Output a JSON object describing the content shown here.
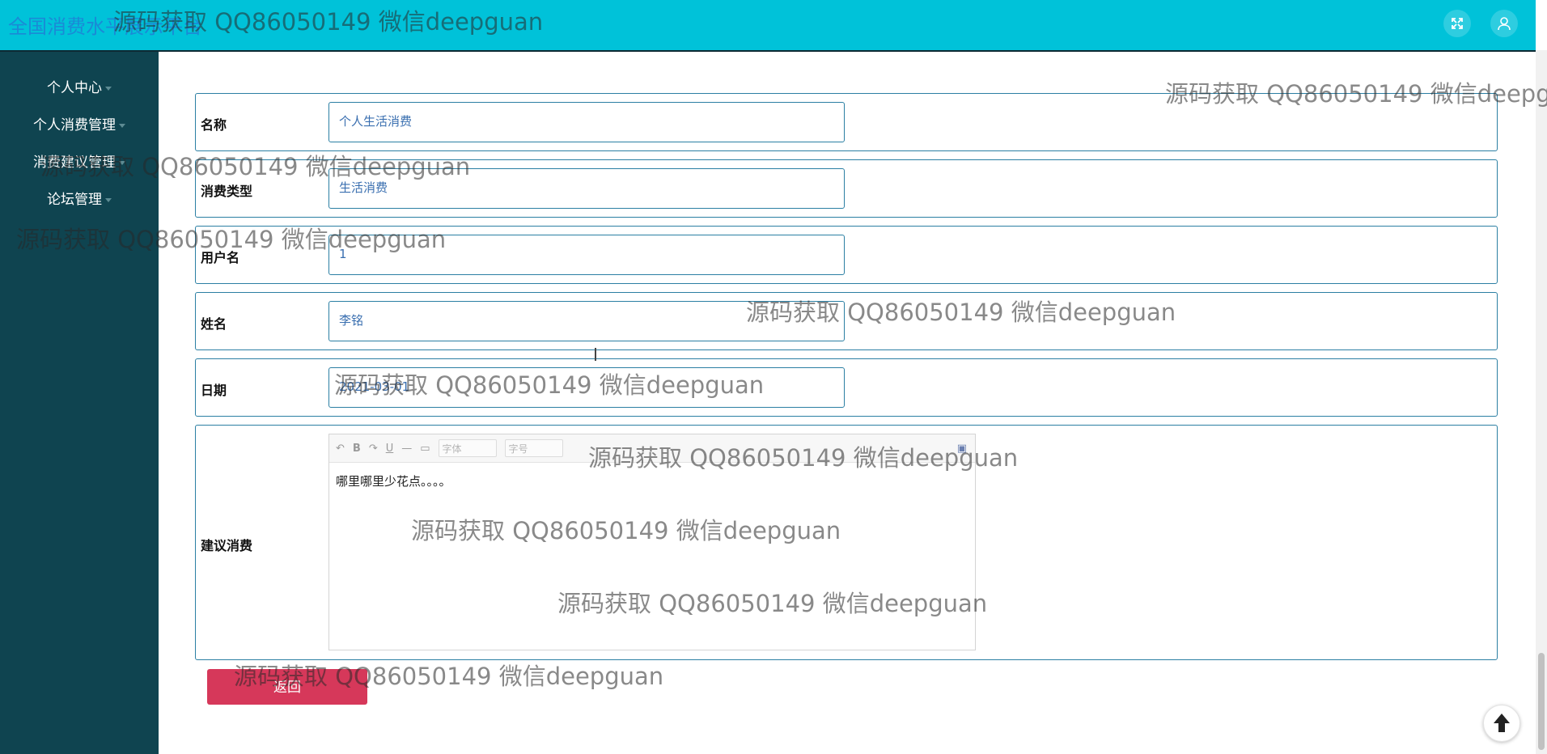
{
  "app": {
    "title": "全国消费水平展示平台"
  },
  "header": {
    "fullscreen_icon": "expand-icon",
    "user_icon": "user-icon"
  },
  "sidebar": {
    "items": [
      {
        "label": "个人中心"
      },
      {
        "label": "个人消费管理"
      },
      {
        "label": "消费建议管理"
      },
      {
        "label": "论坛管理"
      }
    ]
  },
  "form": {
    "name": {
      "label": "名称",
      "value": "个人生活消费"
    },
    "type": {
      "label": "消费类型",
      "value": "生活消费"
    },
    "username": {
      "label": "用户名",
      "value": "1"
    },
    "realname": {
      "label": "姓名",
      "value": "李铭"
    },
    "date": {
      "label": "日期",
      "value": "2021-03-01"
    },
    "advice": {
      "label": "建议消费",
      "content": "哪里哪里少花点。。。。",
      "toolbar": {
        "font_placeholder": "字体",
        "size_placeholder": "字号"
      }
    }
  },
  "actions": {
    "return_label": "返回"
  },
  "watermark": "源码获取 QQ86050149 微信deepguan",
  "colors": {
    "header": "#00c2d9",
    "sidebar": "#0f4450",
    "accent": "#2b7fa3",
    "return": "#d6385a"
  }
}
